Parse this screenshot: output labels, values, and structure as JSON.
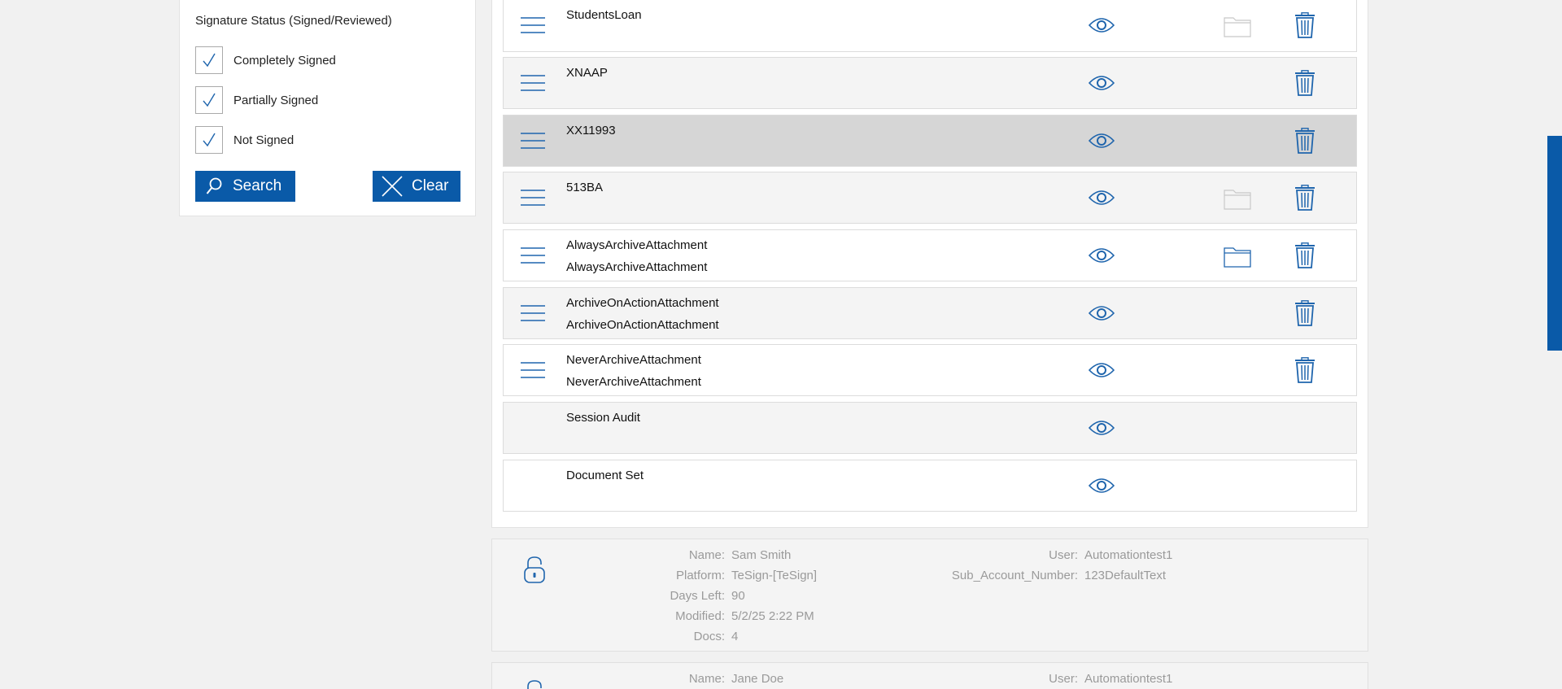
{
  "filter": {
    "title": "Signature Status (Signed/Reviewed)",
    "options": [
      {
        "label": "Completely Signed",
        "checked": true
      },
      {
        "label": "Partially Signed",
        "checked": true
      },
      {
        "label": "Not Signed",
        "checked": true
      }
    ],
    "search_label": "Search",
    "clear_label": "Clear"
  },
  "documents": [
    {
      "line1": "StudentsLoan",
      "line2": "",
      "menu": true,
      "folder": "disabled",
      "trash": true
    },
    {
      "line1": "XNAAP",
      "line2": "",
      "menu": true,
      "folder": "none",
      "trash": true
    },
    {
      "line1": "XX11993",
      "line2": "",
      "menu": true,
      "folder": "none",
      "trash": true,
      "selected": true
    },
    {
      "line1": "513BA",
      "line2": "",
      "menu": true,
      "folder": "disabled",
      "trash": true
    },
    {
      "line1": "AlwaysArchiveAttachment",
      "line2": "AlwaysArchiveAttachment",
      "menu": true,
      "folder": "active",
      "trash": true
    },
    {
      "line1": "ArchiveOnActionAttachment",
      "line2": "ArchiveOnActionAttachment",
      "menu": true,
      "folder": "none",
      "trash": true
    },
    {
      "line1": "NeverArchiveAttachment",
      "line2": "NeverArchiveAttachment",
      "menu": true,
      "folder": "none",
      "trash": true
    },
    {
      "line1": "Session Audit",
      "line2": "",
      "menu": false,
      "folder": "none",
      "trash": false
    },
    {
      "line1": "Document Set",
      "line2": "",
      "menu": false,
      "folder": "none",
      "trash": false
    }
  ],
  "sessions": [
    {
      "fields": [
        {
          "label": "Name:",
          "value": "Sam Smith"
        },
        {
          "label": "Platform:",
          "value": "TeSign-[TeSign]"
        },
        {
          "label": "Days Left:",
          "value": "90"
        },
        {
          "label": "Modified:",
          "value": "5/2/25 2:22 PM"
        },
        {
          "label": "Docs:",
          "value": "4"
        }
      ],
      "right_fields": [
        {
          "label": "User:",
          "value": "Automationtest1"
        },
        {
          "label": "Sub_Account_Number:",
          "value": "123DefaultText"
        }
      ]
    },
    {
      "fields": [
        {
          "label": "Name:",
          "value": "Jane Doe"
        }
      ],
      "right_fields": [
        {
          "label": "User:",
          "value": "Automationtest1"
        }
      ]
    }
  ],
  "colors": {
    "accent": "#0a5aa8",
    "icon_blue": "#1f65ad",
    "folder_disabled": "#c8c8c8",
    "muted_text": "#9a9a9a"
  }
}
